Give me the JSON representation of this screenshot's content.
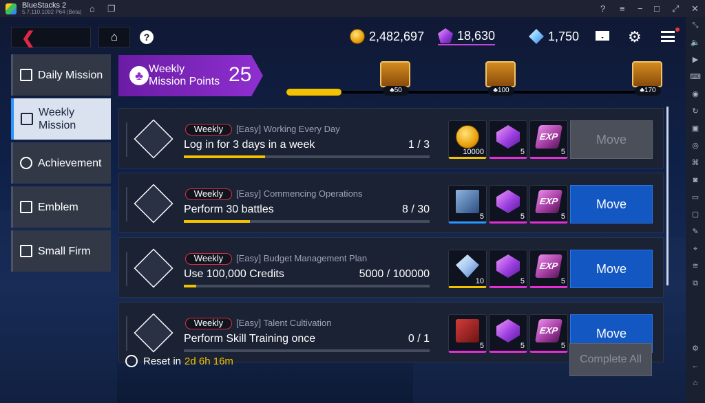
{
  "window": {
    "app_name": "BlueStacks 2",
    "version": "5.7.110.1002  P64 (Beta)"
  },
  "topbar": {
    "gold": "2,482,697",
    "gems": "18,630",
    "crystals": "1,750",
    "help_glyph": "?"
  },
  "tabs": [
    {
      "label": "Daily Mission"
    },
    {
      "label": "Weekly Mission",
      "active": true
    },
    {
      "label": "Achievement"
    },
    {
      "label": "Emblem"
    },
    {
      "label": "Small Firm"
    }
  ],
  "weekly_points": {
    "label": "Weekly Mission Points",
    "value": "25",
    "progress": 0.15,
    "chests": [
      {
        "need": "50"
      },
      {
        "need": "100"
      },
      {
        "need": "170"
      }
    ]
  },
  "missions": [
    {
      "tag": "Weekly",
      "subtitle": "[Easy] Working Every Day",
      "title": "Log in for 3 days in a week",
      "progress": "1 / 3",
      "fill": 0.33,
      "rewards": [
        {
          "kind": "coin",
          "count": "10000"
        },
        {
          "kind": "gem",
          "count": "5"
        },
        {
          "kind": "exp",
          "count": "5"
        }
      ],
      "button": "Move",
      "enabled": false
    },
    {
      "tag": "Weekly",
      "subtitle": "[Easy] Commencing Operations",
      "title": "Perform 30 battles",
      "progress": "8 / 30",
      "fill": 0.27,
      "rewards": [
        {
          "kind": "book",
          "count": "5"
        },
        {
          "kind": "gem",
          "count": "5"
        },
        {
          "kind": "exp",
          "count": "5"
        }
      ],
      "button": "Move",
      "enabled": true
    },
    {
      "tag": "Weekly",
      "subtitle": "[Easy] Budget Management Plan",
      "title": "Use 100,000 Credits",
      "progress": "5000 / 100000",
      "fill": 0.05,
      "rewards": [
        {
          "kind": "diamond",
          "count": "10"
        },
        {
          "kind": "gem",
          "count": "5"
        },
        {
          "kind": "exp",
          "count": "5"
        }
      ],
      "button": "Move",
      "enabled": true
    },
    {
      "tag": "Weekly",
      "subtitle": "[Easy] Talent Cultivation",
      "title": "Perform Skill Training once",
      "progress": "0 / 1",
      "fill": 0,
      "rewards": [
        {
          "kind": "red",
          "count": "5"
        },
        {
          "kind": "gem",
          "count": "5"
        },
        {
          "kind": "exp",
          "count": "5"
        }
      ],
      "button": "Move",
      "enabled": true
    }
  ],
  "footer": {
    "reset_label": "Reset in",
    "reset_time": "2d 6h 16m",
    "complete_all": "Complete All"
  },
  "colors": {
    "accent": "#1357c3",
    "highlight": "#f2c200",
    "purple": "#8f2fd0",
    "tag_border": "#e0303c"
  }
}
